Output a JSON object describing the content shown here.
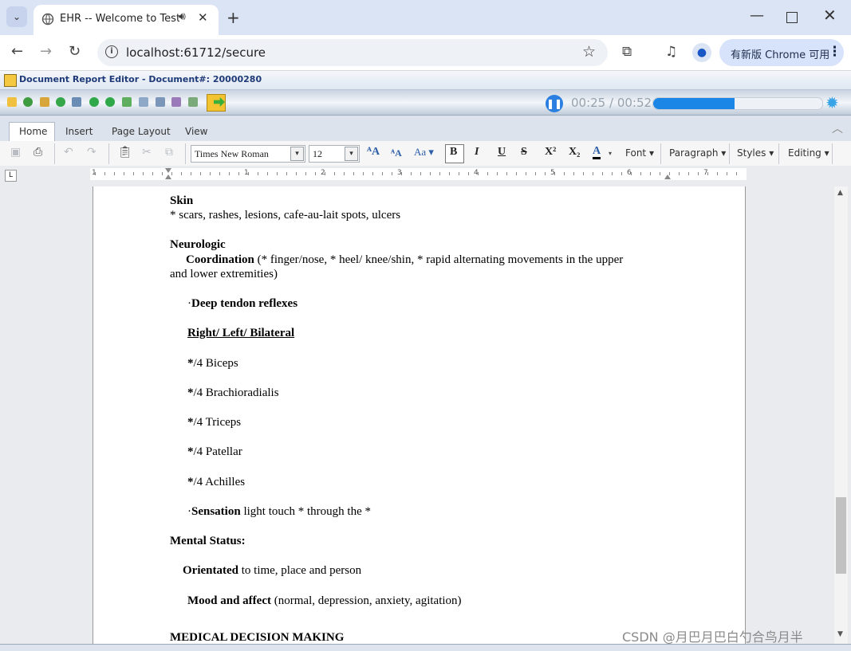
{
  "browser": {
    "tab_title": "EHR -- Welcome to Test H",
    "url": "localhost:61712/secure",
    "chrome_pill": "有新版 Chrome 可用"
  },
  "app": {
    "title": "Document Report Editor - Document#: 20000280",
    "audio": {
      "time": "00:25 / 00:52",
      "progress": 0.48
    }
  },
  "ribbon": {
    "tabs": [
      "Home",
      "Insert",
      "Page Layout",
      "View"
    ],
    "font_name": "Times New Roman",
    "font_size": "12",
    "groups": [
      "Font",
      "Paragraph",
      "Styles",
      "Editing"
    ]
  },
  "ruler": {
    "numbers": [
      "1",
      "1",
      "2",
      "3",
      "4",
      "5",
      "6",
      "7"
    ]
  },
  "document": {
    "skin_heading": "Skin",
    "skin_text": "* scars, rashes, lesions, cafe-au-lait spots, ulcers",
    "neuro_heading": "Neurologic",
    "coord_label": "Coordination",
    "coord_text_1": " (* finger/nose, * heel/ knee/shin, * rapid alternating movements in the upper",
    "coord_text_2": "and lower extremities)",
    "dtr_bullet": "·",
    "dtr_label": "Deep tendon reflexes",
    "side_heading": "Right/ Left/ Bilateral",
    "reflexes": [
      {
        "star": "*",
        "text": "/4 Biceps"
      },
      {
        "star": "*",
        "text": "/4 Brachioradialis"
      },
      {
        "star": "*",
        "text": "/4 Triceps"
      },
      {
        "star": "*",
        "text": "/4 Patellar"
      },
      {
        "star": "*",
        "text": "/4 Achilles"
      }
    ],
    "sensation_bullet": "·",
    "sensation_label": "Sensation",
    "sensation_text": " light touch * through the *",
    "mental_heading": "Mental Status:",
    "orient_label": "Orientated",
    "orient_text": " to time, place and person",
    "mood_label": "Mood and affect",
    "mood_text": " (normal, depression, anxiety, agitation)",
    "mdm_heading": "MEDICAL DECISION MAKING"
  },
  "watermark": "CSDN @月巴月巴白勺合鸟月半"
}
